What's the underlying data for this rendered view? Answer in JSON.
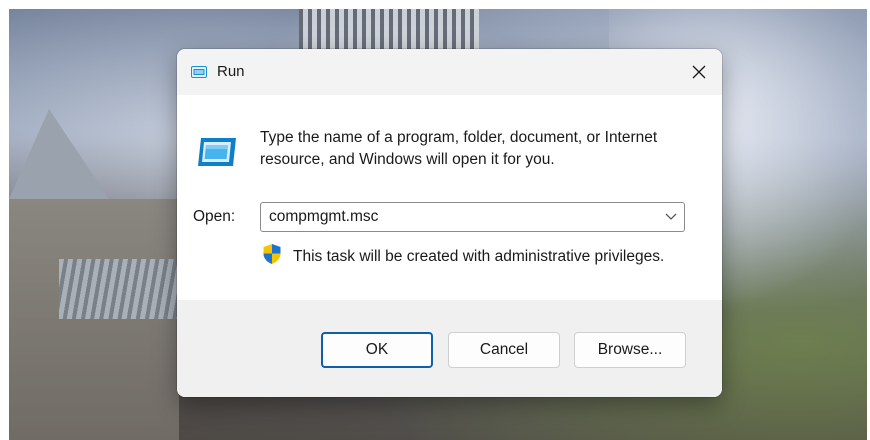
{
  "dialog": {
    "title": "Run",
    "close_symbol": "×",
    "description": "Type the name of a program, folder, document, or Internet resource, and Windows will open it for you.",
    "open_label": "Open:",
    "open_value": "compmgmt.msc",
    "admin_notice": "This task will be created with administrative privileges.",
    "buttons": {
      "ok": "OK",
      "cancel": "Cancel",
      "browse": "Browse..."
    },
    "icons": {
      "title_icon": "run-app-icon",
      "main_icon": "run-app-icon",
      "close_icon": "close-icon",
      "dropdown_icon": "chevron-down-icon",
      "shield_icon": "uac-shield-icon"
    }
  },
  "colors": {
    "accent": "#0f5ea8",
    "icon_blue": "#1b8fd6"
  }
}
